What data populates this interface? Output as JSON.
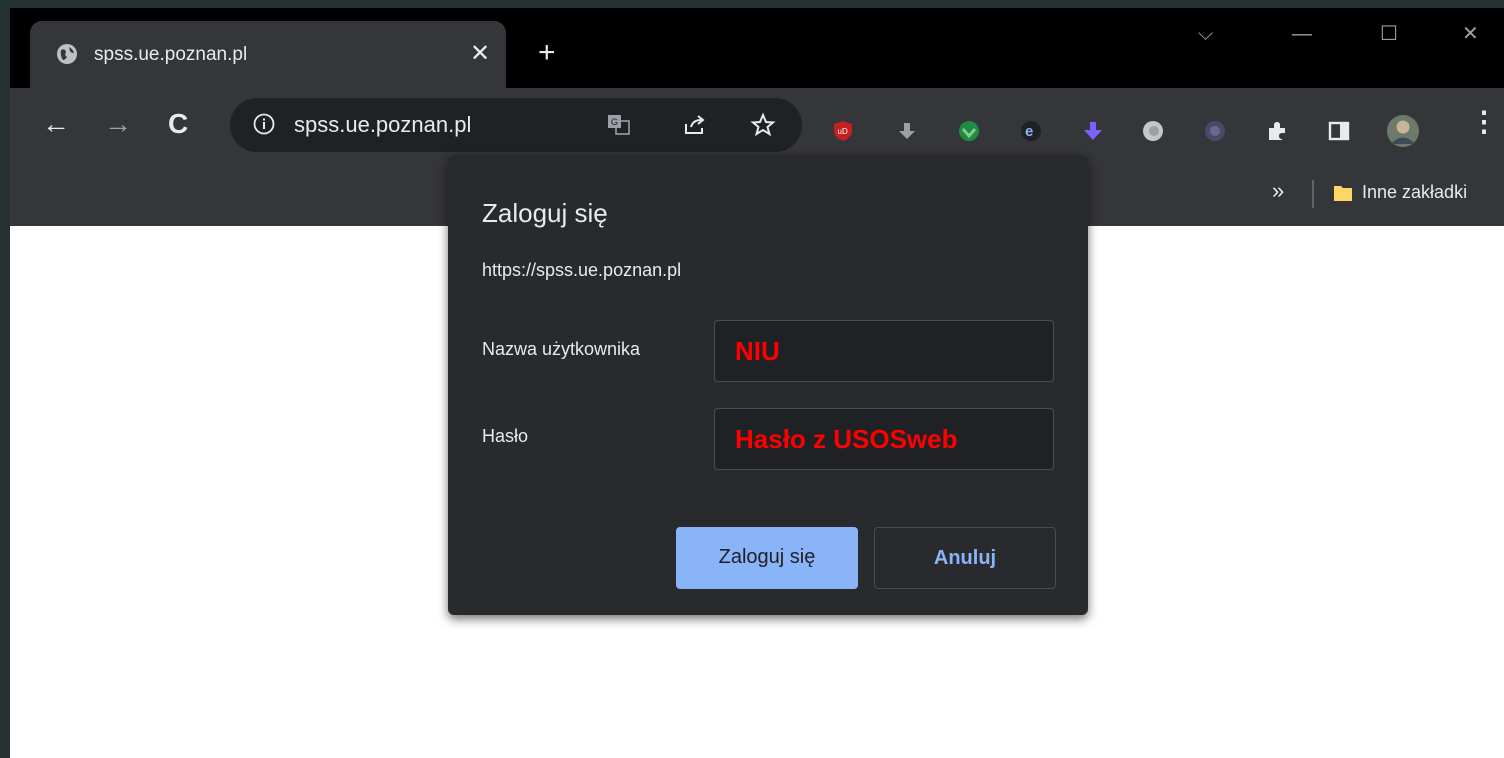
{
  "tab": {
    "title": "spss.ue.poznan.pl",
    "close_glyph": "✕",
    "favicon": "globe-icon"
  },
  "new_tab_glyph": "+",
  "window_controls": {
    "dropdown": "⌵",
    "minimize": "—",
    "maximize": "☐",
    "close": "✕"
  },
  "toolbar": {
    "back": "←",
    "forward": "→",
    "reload": "C",
    "url": "spss.ue.poznan.pl",
    "menu": "⋮"
  },
  "bookmarks": {
    "overflow": "»",
    "other_bookmarks": "Inne zakładki"
  },
  "dialog": {
    "title": "Zaloguj się",
    "url": "https://spss.ue.poznan.pl",
    "username_label": "Nazwa użytkownika",
    "username_value": "NIU",
    "password_label": "Hasło",
    "password_value": "Hasło z USOSweb",
    "submit_label": "Zaloguj się",
    "cancel_label": "Anuluj"
  },
  "colors": {
    "accent": "#8ab4f8",
    "annotation": "#ff0000",
    "dialog_bg": "#292a2d"
  }
}
